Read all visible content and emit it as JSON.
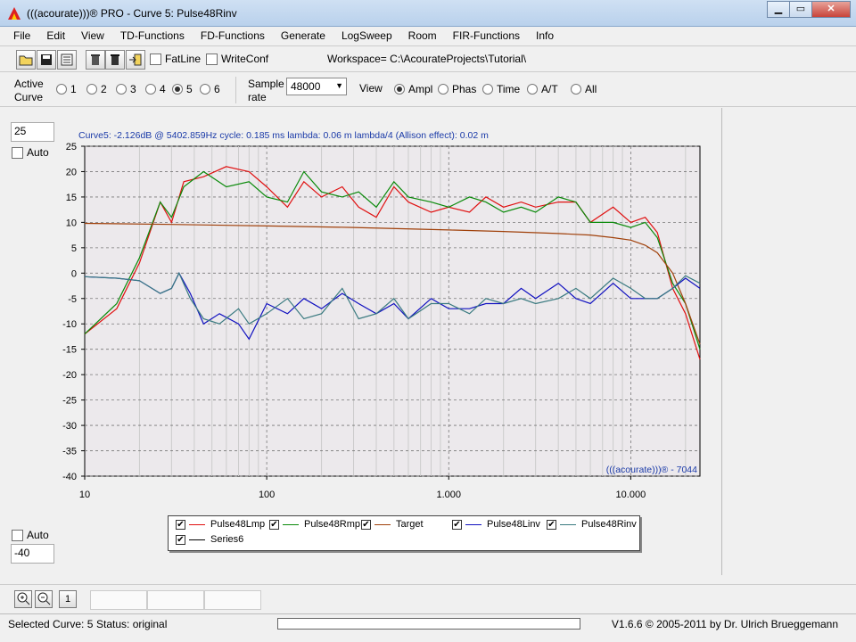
{
  "window": {
    "title": "(((acourate)))® PRO - Curve 5: Pulse48Rinv"
  },
  "menu": [
    "File",
    "Edit",
    "View",
    "TD-Functions",
    "FD-Functions",
    "Generate",
    "LogSweep",
    "Room",
    "FIR-Functions",
    "Info"
  ],
  "toolbar": {
    "fatline_label": "FatLine",
    "writeconf_label": "WriteConf",
    "workspace_label": "Workspace=",
    "workspace_path": "C:\\AcourateProjects\\Tutorial\\"
  },
  "active_curve": {
    "label_line1": "Active",
    "label_line2": "Curve",
    "options": [
      "1",
      "2",
      "3",
      "4",
      "5",
      "6"
    ],
    "selected": "5"
  },
  "sample_rate": {
    "label_line1": "Sample",
    "label_line2": "rate",
    "value": "48000"
  },
  "view": {
    "label": "View",
    "options": [
      "Ampl",
      "Phas",
      "Time",
      "A/T",
      "All"
    ],
    "selected": "Ampl"
  },
  "ymax": {
    "value": "25",
    "auto_label": "Auto"
  },
  "ymin": {
    "value": "-40",
    "auto_label": "Auto"
  },
  "info_line": "Curve5:  -2.126dB @ 5402.859Hz    cycle: 0.185 ms   lambda: 0.06 m   lambda/4 (Allison effect): 0.02 m",
  "watermark": "(((acourate)))® - 7044",
  "colors": {
    "red": "#e01010",
    "green": "#0a8a0a",
    "brown": "#a0400a",
    "blue": "#1010c0",
    "teal": "#3a7a80",
    "black": "#000000"
  },
  "chart_data": {
    "type": "line",
    "x_scale": "log",
    "xlim": [
      10,
      24000
    ],
    "ylim": [
      -40,
      25
    ],
    "x_ticks": [
      {
        "v": 10,
        "label": "10"
      },
      {
        "v": 100,
        "label": "100"
      },
      {
        "v": 1000,
        "label": "1.000"
      },
      {
        "v": 10000,
        "label": "10.000"
      }
    ],
    "y_ticks": [
      25,
      20,
      15,
      10,
      5,
      0,
      -5,
      -10,
      -15,
      -20,
      -25,
      -30,
      -35,
      -40
    ],
    "grid": true,
    "series": [
      {
        "name": "Pulse48Lmp",
        "color": "#e01010",
        "points": [
          [
            10,
            -12
          ],
          [
            15,
            -7
          ],
          [
            20,
            2
          ],
          [
            26,
            14
          ],
          [
            30,
            10
          ],
          [
            35,
            18
          ],
          [
            45,
            19
          ],
          [
            60,
            21
          ],
          [
            80,
            20
          ],
          [
            100,
            17
          ],
          [
            130,
            13
          ],
          [
            160,
            18
          ],
          [
            200,
            15
          ],
          [
            260,
            17
          ],
          [
            320,
            13
          ],
          [
            400,
            11
          ],
          [
            500,
            17
          ],
          [
            600,
            14
          ],
          [
            800,
            12
          ],
          [
            1000,
            13
          ],
          [
            1300,
            12
          ],
          [
            1600,
            15
          ],
          [
            2000,
            13
          ],
          [
            2500,
            14
          ],
          [
            3000,
            13
          ],
          [
            4000,
            14
          ],
          [
            5000,
            14
          ],
          [
            6000,
            10
          ],
          [
            8000,
            13
          ],
          [
            10000,
            10
          ],
          [
            12000,
            11
          ],
          [
            14000,
            8
          ],
          [
            17000,
            -3
          ],
          [
            20000,
            -8
          ],
          [
            24000,
            -17
          ]
        ]
      },
      {
        "name": "Pulse48Rmp",
        "color": "#0a8a0a",
        "points": [
          [
            10,
            -12
          ],
          [
            15,
            -6
          ],
          [
            20,
            3
          ],
          [
            26,
            14
          ],
          [
            30,
            11
          ],
          [
            35,
            17
          ],
          [
            45,
            20
          ],
          [
            60,
            17
          ],
          [
            80,
            18
          ],
          [
            100,
            15
          ],
          [
            130,
            14
          ],
          [
            160,
            20
          ],
          [
            200,
            16
          ],
          [
            260,
            15
          ],
          [
            320,
            16
          ],
          [
            400,
            13
          ],
          [
            500,
            18
          ],
          [
            600,
            15
          ],
          [
            800,
            14
          ],
          [
            1000,
            13
          ],
          [
            1300,
            15
          ],
          [
            1600,
            14
          ],
          [
            2000,
            12
          ],
          [
            2500,
            13
          ],
          [
            3000,
            12
          ],
          [
            4000,
            15
          ],
          [
            5000,
            14
          ],
          [
            6000,
            10
          ],
          [
            8000,
            10
          ],
          [
            10000,
            9
          ],
          [
            12000,
            10
          ],
          [
            14000,
            7
          ],
          [
            17000,
            -2
          ],
          [
            20000,
            -6
          ],
          [
            24000,
            -15
          ]
        ]
      },
      {
        "name": "Target",
        "color": "#a0400a",
        "points": [
          [
            10,
            9.8
          ],
          [
            30,
            9.6
          ],
          [
            100,
            9.3
          ],
          [
            300,
            9.0
          ],
          [
            1000,
            8.5
          ],
          [
            2000,
            8.2
          ],
          [
            4000,
            7.8
          ],
          [
            6000,
            7.5
          ],
          [
            8000,
            7.0
          ],
          [
            10000,
            6.5
          ],
          [
            12000,
            5.5
          ],
          [
            14000,
            4.0
          ],
          [
            17000,
            0
          ],
          [
            20000,
            -6
          ],
          [
            24000,
            -14
          ]
        ]
      },
      {
        "name": "Pulse48Linv",
        "color": "#1010c0",
        "points": [
          [
            10,
            -0.7
          ],
          [
            15,
            -1
          ],
          [
            20,
            -1.5
          ],
          [
            26,
            -4
          ],
          [
            30,
            -3
          ],
          [
            33,
            0
          ],
          [
            38,
            -4
          ],
          [
            45,
            -10
          ],
          [
            55,
            -8
          ],
          [
            70,
            -10
          ],
          [
            80,
            -13
          ],
          [
            100,
            -6
          ],
          [
            130,
            -8
          ],
          [
            160,
            -5
          ],
          [
            200,
            -7
          ],
          [
            260,
            -4
          ],
          [
            320,
            -6
          ],
          [
            400,
            -8
          ],
          [
            500,
            -6
          ],
          [
            600,
            -9
          ],
          [
            800,
            -5
          ],
          [
            1000,
            -7
          ],
          [
            1300,
            -7
          ],
          [
            1600,
            -6
          ],
          [
            2000,
            -6
          ],
          [
            2500,
            -3
          ],
          [
            3000,
            -5
          ],
          [
            4000,
            -2
          ],
          [
            5000,
            -5
          ],
          [
            6000,
            -6
          ],
          [
            8000,
            -2
          ],
          [
            10000,
            -5
          ],
          [
            12000,
            -5
          ],
          [
            14000,
            -5
          ],
          [
            17000,
            -3
          ],
          [
            20000,
            -1
          ],
          [
            24000,
            -3
          ]
        ]
      },
      {
        "name": "Pulse48Rinv",
        "color": "#3a7a80",
        "points": [
          [
            10,
            -0.7
          ],
          [
            15,
            -1
          ],
          [
            20,
            -1.5
          ],
          [
            26,
            -4
          ],
          [
            30,
            -3
          ],
          [
            33,
            0
          ],
          [
            38,
            -5
          ],
          [
            45,
            -9
          ],
          [
            55,
            -10
          ],
          [
            70,
            -7
          ],
          [
            80,
            -10
          ],
          [
            100,
            -8
          ],
          [
            130,
            -5
          ],
          [
            160,
            -9
          ],
          [
            200,
            -8
          ],
          [
            260,
            -3
          ],
          [
            320,
            -9
          ],
          [
            400,
            -8
          ],
          [
            500,
            -5
          ],
          [
            600,
            -9
          ],
          [
            800,
            -6
          ],
          [
            1000,
            -6
          ],
          [
            1300,
            -8
          ],
          [
            1600,
            -5
          ],
          [
            2000,
            -6
          ],
          [
            2500,
            -5
          ],
          [
            3000,
            -6
          ],
          [
            4000,
            -5
          ],
          [
            5000,
            -3
          ],
          [
            6000,
            -5
          ],
          [
            8000,
            -1
          ],
          [
            10000,
            -3
          ],
          [
            12000,
            -5
          ],
          [
            14000,
            -5
          ],
          [
            17000,
            -3
          ],
          [
            20000,
            -0.5
          ],
          [
            24000,
            -2
          ]
        ]
      },
      {
        "name": "Series6",
        "color": "#000000",
        "points": []
      }
    ]
  },
  "legend_checked": "✔",
  "zoom": {
    "reset_label": "1"
  },
  "status": {
    "selected_curve": "Selected Curve: 5",
    "status": "Status: original",
    "version": "V1.6.6 © 2005-2011 by Dr. Ulrich Brueggemann"
  }
}
